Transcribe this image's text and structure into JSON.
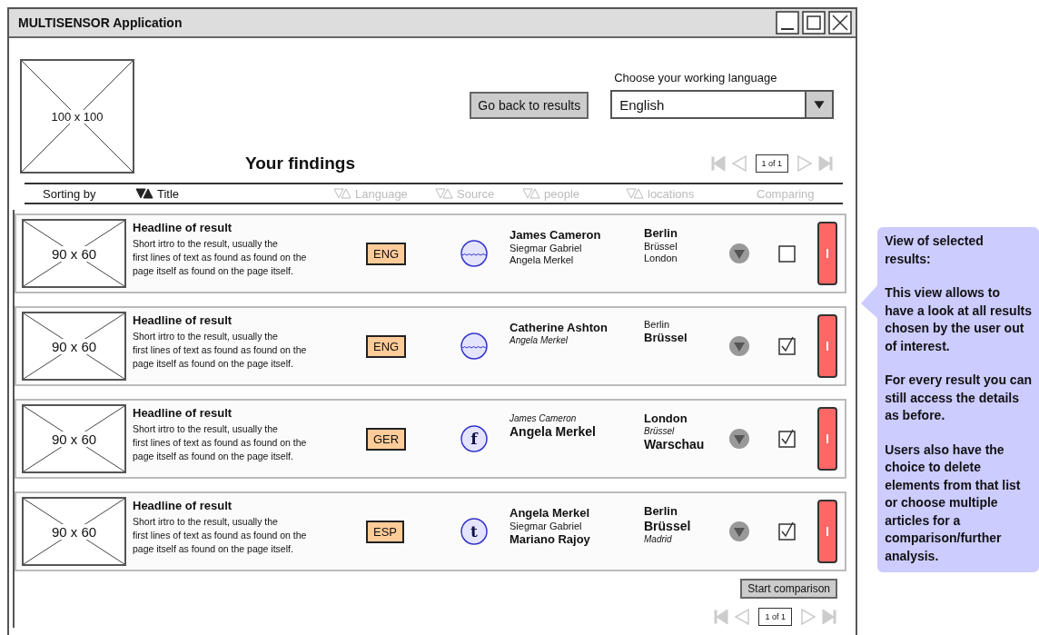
{
  "window": {
    "title": "MULTISENSOR Application"
  },
  "header": {
    "logo": "100 x 100",
    "back_button": "Go back to results",
    "language_label": "Choose your working language",
    "language_value": "English",
    "heading": "Your findings"
  },
  "pager_top": {
    "page": "1 of 1"
  },
  "sort_header": {
    "label": "Sorting by",
    "columns": [
      {
        "label": "Title",
        "kind": "sort",
        "active": true
      },
      {
        "label": "Language",
        "kind": "sort",
        "active": false
      },
      {
        "label": "Source",
        "kind": "sort",
        "active": false
      },
      {
        "label": "people",
        "kind": "sort",
        "active": false
      },
      {
        "label": "locations",
        "kind": "sort",
        "active": false
      },
      {
        "label": "Comparing",
        "kind": "plain",
        "active": false
      }
    ]
  },
  "results": [
    {
      "thumb": "90 x 60",
      "headline": "Headline of result",
      "intro": "Short irtro to the result, usually the\nfirst lines of text as found as found on the\npage itself as found on the page itself.",
      "language": "ENG",
      "source": {
        "kind": "web"
      },
      "people": [
        {
          "name": "James Cameron",
          "kind": "strong"
        },
        {
          "name": "Siegmar Gabriel",
          "kind": "normal"
        },
        {
          "name": "Angela Merkel",
          "kind": "normal"
        }
      ],
      "locations": [
        {
          "name": "Berlin",
          "kind": "strong"
        },
        {
          "name": "Brüssel",
          "kind": "normal"
        },
        {
          "name": "London",
          "kind": "normal"
        }
      ],
      "checked": false
    },
    {
      "thumb": "90 x 60",
      "headline": "Headline of result",
      "intro": "Short irtro to the result, usually the\nfirst lines of text as found as found on the\npage itself as found on the page itself.",
      "language": "ENG",
      "source": {
        "kind": "web"
      },
      "people": [
        {
          "name": "Catherine Ashton",
          "kind": "strong"
        },
        {
          "name": "Angela Merkel",
          "kind": "light"
        }
      ],
      "locations": [
        {
          "name": "Berlin",
          "kind": "normal"
        },
        {
          "name": "Brüssel",
          "kind": "strong"
        }
      ],
      "checked": true
    },
    {
      "thumb": "90 x 60",
      "headline": "Headline of result",
      "intro": "Short irtro to the result, usually the\nfirst lines of text as found as found on the\npage itself as found on the page itself.",
      "language": "GER",
      "source": {
        "kind": "letter",
        "glyph": "f"
      },
      "people": [
        {
          "name": "James Cameron",
          "kind": "light"
        },
        {
          "name": "Angela Merkel",
          "kind": "large"
        }
      ],
      "locations": [
        {
          "name": "London",
          "kind": "strong"
        },
        {
          "name": "Brüssel",
          "kind": "light"
        },
        {
          "name": "Warschau",
          "kind": "large"
        }
      ],
      "checked": true
    },
    {
      "thumb": "90 x 60",
      "headline": "Headline of result",
      "intro": "Short irtro to the result, usually the\nfirst lines of text as found as found on the\npage itself as found on the page itself.",
      "language": "ESP",
      "source": {
        "kind": "letter",
        "glyph": "t"
      },
      "people": [
        {
          "name": "Angela Merkel",
          "kind": "strong"
        },
        {
          "name": "Siegmar Gabriel",
          "kind": "normal"
        },
        {
          "name": "Mariano Rajoy",
          "kind": "strong"
        }
      ],
      "locations": [
        {
          "name": "Berlin",
          "kind": "strong"
        },
        {
          "name": "Brüssel",
          "kind": "large"
        },
        {
          "name": "Madrid",
          "kind": "light"
        }
      ],
      "checked": true
    }
  ],
  "compare_button": "Start comparison",
  "pager_bottom": {
    "page": "1 of 1"
  },
  "callout": {
    "paragraphs": [
      "View of selected results:",
      "This view allows to have a look at all results chosen by the user out of interest.",
      "For every result you can still access the details as before.",
      "Users also have the choice to delete elements from that list or choose multiple articles for a comparison/further analysis."
    ]
  }
}
